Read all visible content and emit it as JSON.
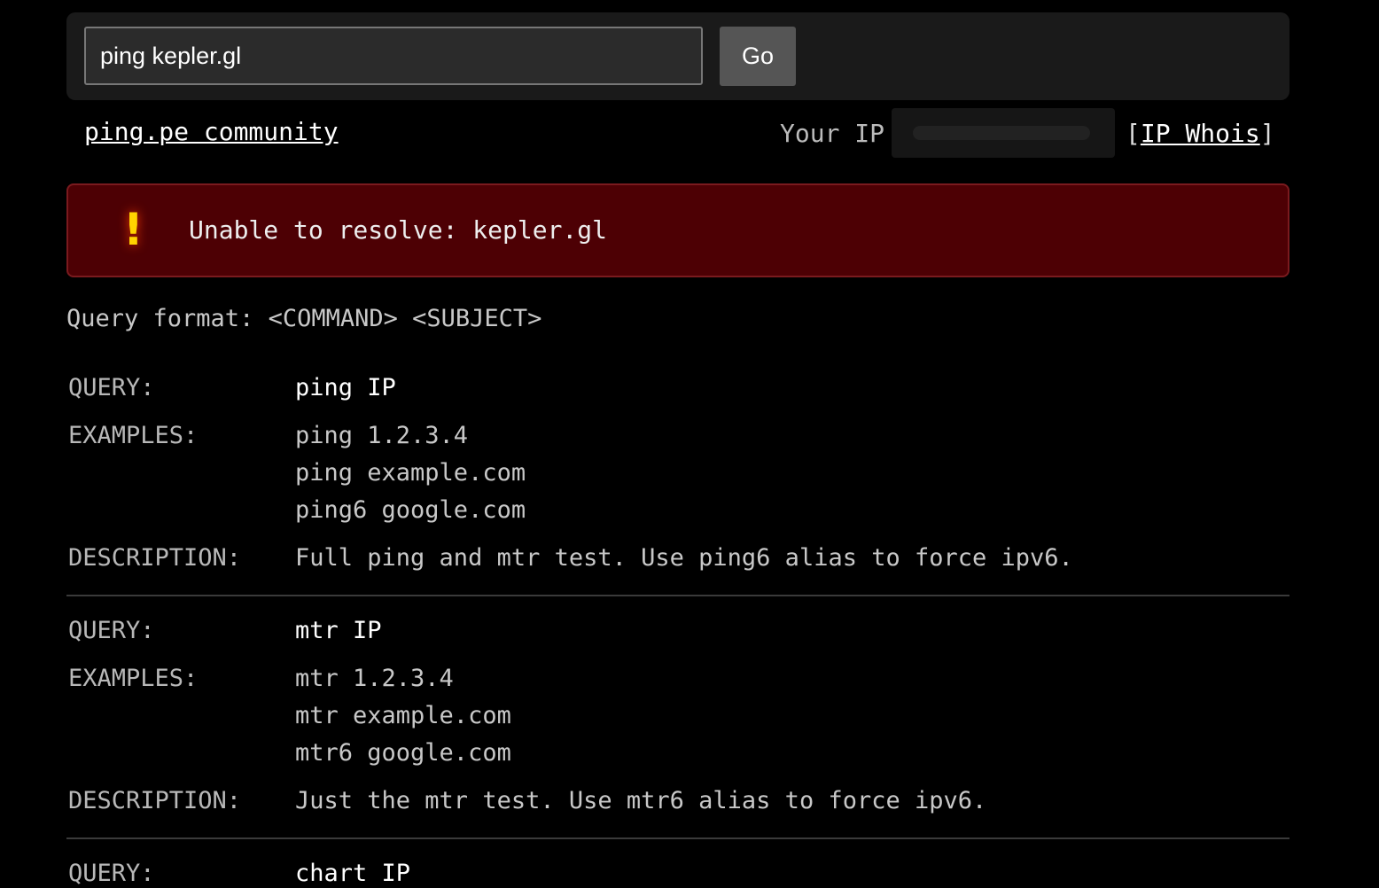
{
  "search": {
    "value": "ping kepler.gl",
    "button_label": "Go"
  },
  "links": {
    "community": "ping.pe community"
  },
  "ip": {
    "label": "Your IP",
    "value": "",
    "whois_open": "[",
    "whois_label": "IP Whois",
    "whois_close": "]"
  },
  "error": {
    "icon": "!",
    "message": "Unable to resolve: kepler.gl",
    "background": "#4d0004",
    "icon_color": "#ffd400"
  },
  "format_line": "Query format: <COMMAND> <SUBJECT>",
  "labels": {
    "query": "QUERY:",
    "examples": "EXAMPLES:",
    "description": "DESCRIPTION:"
  },
  "entries": [
    {
      "query": "ping IP",
      "examples": [
        "ping 1.2.3.4",
        "ping example.com",
        "ping6 google.com"
      ],
      "description": "Full ping and mtr test. Use ping6 alias to force ipv6."
    },
    {
      "query": "mtr IP",
      "examples": [
        "mtr 1.2.3.4",
        "mtr example.com",
        "mtr6 google.com"
      ],
      "description": "Just the mtr test. Use mtr6 alias to force ipv6."
    },
    {
      "query": "chart IP"
    }
  ]
}
